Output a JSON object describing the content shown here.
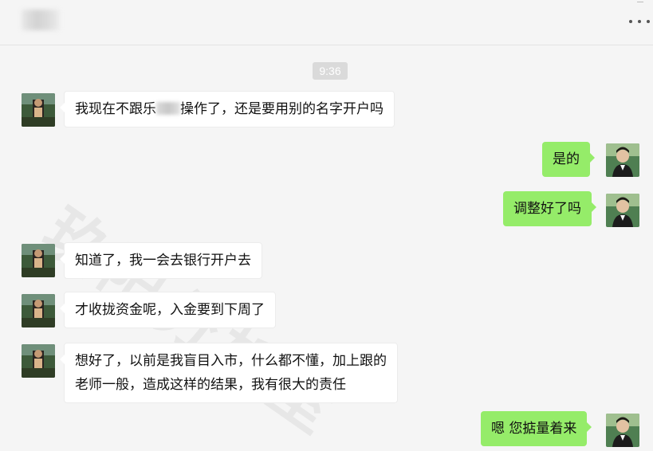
{
  "header": {
    "contact_name": "",
    "more_icon": "more-dots-icon"
  },
  "chat": {
    "timestamp": "9:36",
    "messages": [
      {
        "side": "left",
        "avatar": "contact-avatar",
        "text_before": "我现在不跟乐",
        "text_after": "操作了，还是要用别的名字开户吗"
      },
      {
        "side": "right",
        "avatar": "user-avatar",
        "text": "是的"
      },
      {
        "side": "right",
        "avatar": "user-avatar",
        "text": "调整好了吗"
      },
      {
        "side": "left",
        "avatar": "contact-avatar",
        "text": "知道了，我一会去银行开户去"
      },
      {
        "side": "left",
        "avatar": "contact-avatar",
        "text": "才收拢资金呢，入金要到下周了"
      },
      {
        "side": "left",
        "avatar": "contact-avatar",
        "lines": [
          "想好了，以前是我盲目入市，什么都不懂，加上跟的",
          "老师一般，造成这样的结果，我有很大的责任"
        ]
      },
      {
        "side": "right",
        "avatar": "user-avatar",
        "text": "嗯 您掂量着来"
      }
    ]
  },
  "watermark": "玖阳分析室",
  "colors": {
    "background": "#f5f5f5",
    "incoming_bubble": "#ffffff",
    "outgoing_bubble": "#95ec69",
    "time_badge": "#dadada"
  }
}
